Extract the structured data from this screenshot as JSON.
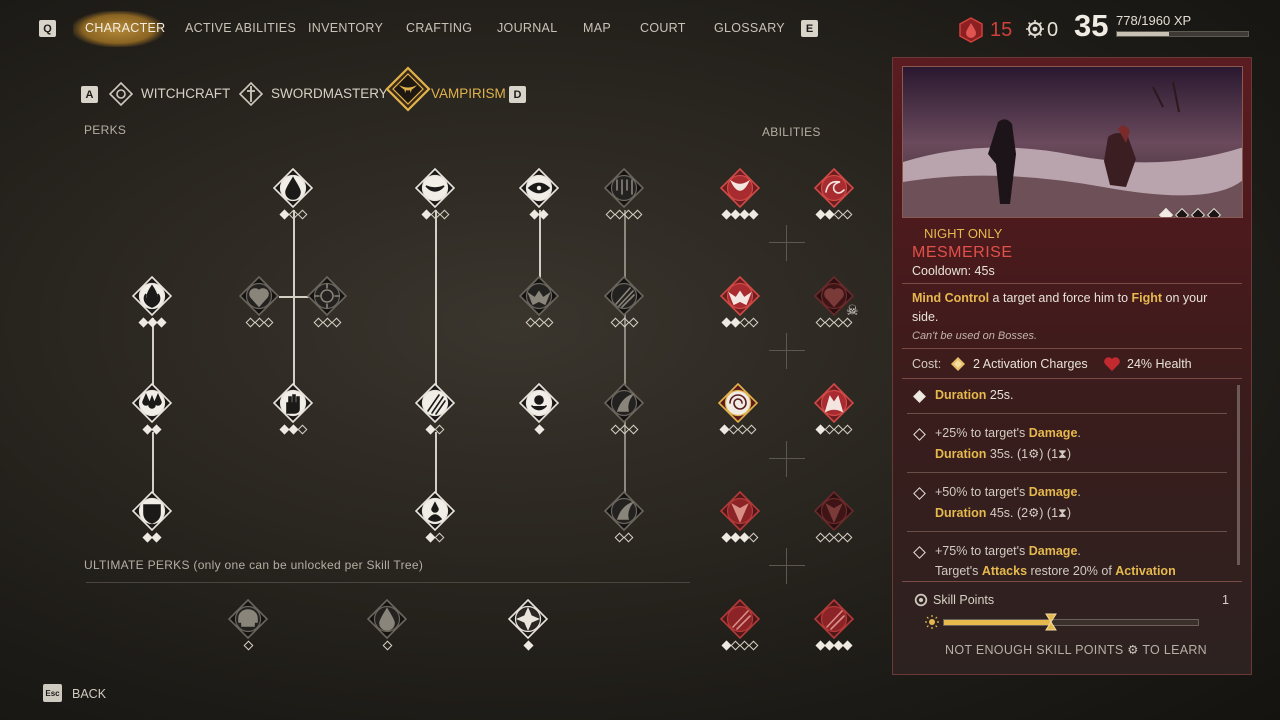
{
  "nav": {
    "left_key": "Q",
    "right_key": "E",
    "tabs": [
      "CHARACTER",
      "ACTIVE ABILITIES",
      "INVENTORY",
      "CRAFTING",
      "JOURNAL",
      "MAP",
      "COURT",
      "GLOSSARY"
    ],
    "active_tab": "CHARACTER"
  },
  "status": {
    "blood_count": "15",
    "gear_count": "0",
    "level": "35",
    "xp": "778/1960 XP",
    "xp_fraction": 0.397
  },
  "trees": {
    "prev_key": "A",
    "next_key": "D",
    "items": [
      "WITCHCRAFT",
      "SWORDMASTERY",
      "VAMPIRISM"
    ],
    "active": "VAMPIRISM"
  },
  "labels": {
    "perks": "PERKS",
    "abilities": "ABILITIES",
    "ultimate": "ULTIMATE PERKS (only one can be unlocked per Skill Tree)"
  },
  "detail": {
    "night_only": "NIGHT ONLY",
    "name": "MESMERISE",
    "cooldown": "Cooldown: 45s",
    "desc_part1": "Mind Control",
    "desc_part2": " a target and force him to ",
    "desc_part3": "Fight",
    "desc_part4": " on your",
    "desc_line2": "side.",
    "note": "Can't be used on Bosses.",
    "cost_label": "Cost:",
    "cost_charges": "2 Activation Charges",
    "cost_health": "24% Health",
    "rows": [
      {
        "title": "Duration",
        "value": "25s."
      },
      {
        "line1a": "+25% to target's ",
        "line1b": "Damage",
        "line1c": ".",
        "line2a": "Duration",
        "line2b": " 35s.  (1",
        "line2c": ") (1",
        "line2d": ")"
      },
      {
        "line1a": "+50% to target's ",
        "line1b": "Damage",
        "line1c": ".",
        "line2a": "Duration",
        "line2b": " 45s.  (2",
        "line2c": ") (1",
        "line2d": ")"
      },
      {
        "line1a": "+75% to target's ",
        "line1b": "Damage",
        "line1c": ".",
        "line2a": "Target's ",
        "line2b": "Attacks",
        "line2c": " restore 20% of ",
        "line2d": "Activation"
      }
    ],
    "skill_points_label": "Skill Points",
    "skill_points_value": "1",
    "day_night_fraction": 0.42,
    "learn_text_a": "NOT ENOUGH SKILL POINTS",
    "learn_text_b": "TO LEARN",
    "image_dots": 4,
    "image_dot_active": 0
  },
  "back": {
    "key": "Esc",
    "label": "BACK"
  },
  "colors": {
    "accent_gold": "#e6b94e",
    "blood_red": "#d0403a",
    "ability_red": "#a82a2e",
    "panel_red": "#5a1c20"
  }
}
